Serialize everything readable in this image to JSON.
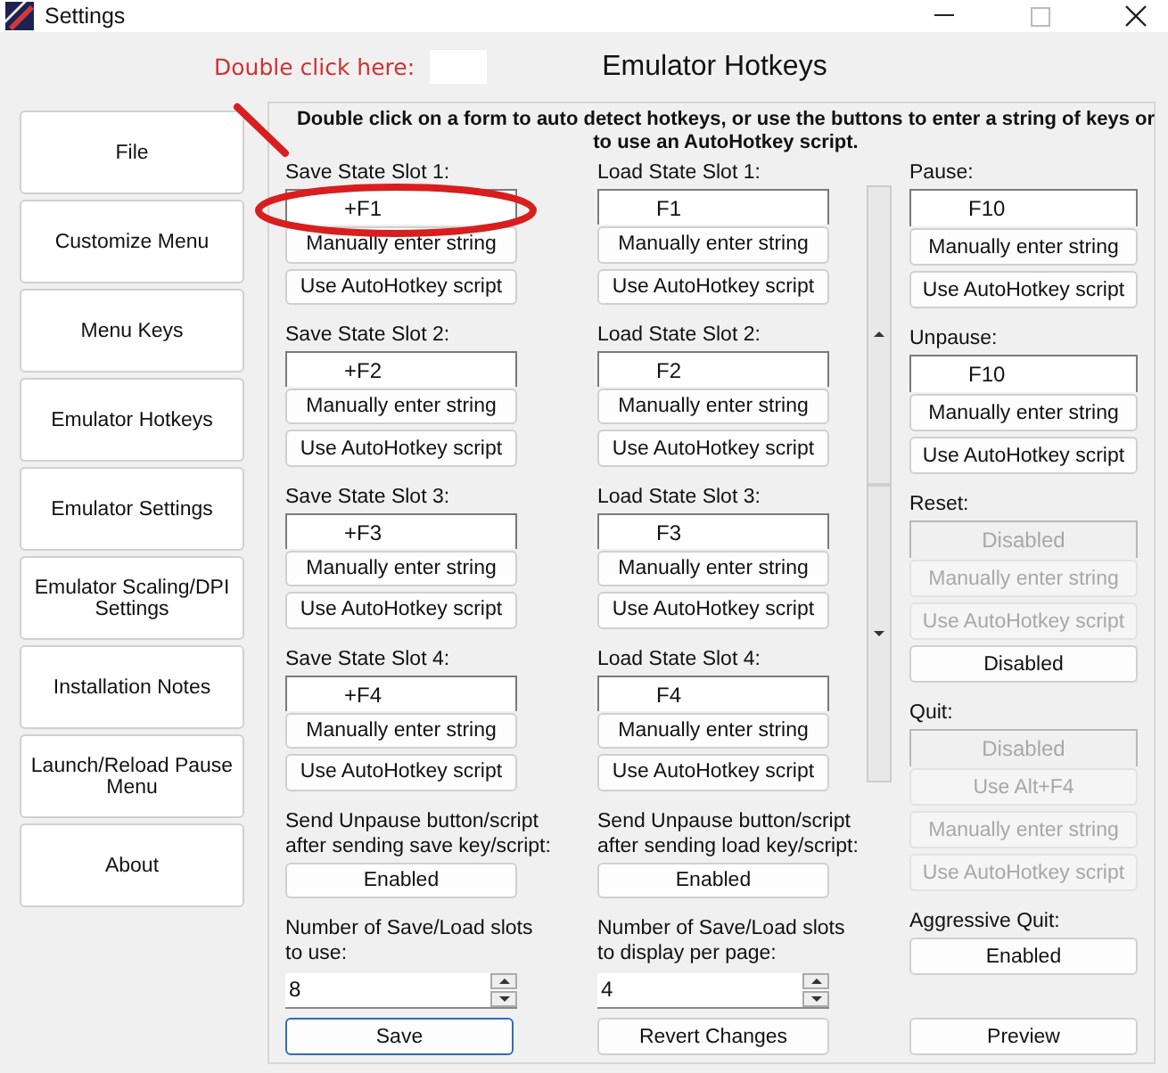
{
  "window": {
    "title": "Settings"
  },
  "annotation": {
    "text": "Double click here:"
  },
  "header": "Emulator Hotkeys",
  "sidebar": {
    "items": [
      {
        "label": "File"
      },
      {
        "label": "Customize Menu"
      },
      {
        "label": "Menu Keys"
      },
      {
        "label": "Emulator Hotkeys"
      },
      {
        "label": "Emulator Settings"
      },
      {
        "label": "Emulator Scaling/DPI Settings"
      },
      {
        "label": "Installation Notes"
      },
      {
        "label": "Launch/Reload Pause Menu"
      },
      {
        "label": "About"
      }
    ]
  },
  "panel": {
    "instructions": "Double click on a form to auto detect hotkeys, or use the buttons to enter a string of keys or to use an AutoHotkey script.",
    "columns": [
      {
        "items": [
          {
            "kind": "label",
            "text": "Save State Slot 1:"
          },
          {
            "kind": "field",
            "value": "+F1",
            "disabled": false
          },
          {
            "kind": "button",
            "label": "Manually enter string",
            "disabled": false
          },
          {
            "kind": "button",
            "label": "Use AutoHotkey script",
            "disabled": false
          },
          {
            "kind": "label",
            "text": "Save State Slot 2:"
          },
          {
            "kind": "field",
            "value": "+F2",
            "disabled": false
          },
          {
            "kind": "button",
            "label": "Manually enter string",
            "disabled": false
          },
          {
            "kind": "button",
            "label": "Use AutoHotkey script",
            "disabled": false
          },
          {
            "kind": "label",
            "text": "Save State Slot 3:"
          },
          {
            "kind": "field",
            "value": "+F3",
            "disabled": false
          },
          {
            "kind": "button",
            "label": "Manually enter string",
            "disabled": false
          },
          {
            "kind": "button",
            "label": "Use AutoHotkey script",
            "disabled": false
          },
          {
            "kind": "label",
            "text": "Save State Slot 4:"
          },
          {
            "kind": "field",
            "value": "+F4",
            "disabled": false
          },
          {
            "kind": "button",
            "label": "Manually enter string",
            "disabled": false
          },
          {
            "kind": "button",
            "label": "Use AutoHotkey script",
            "disabled": false
          },
          {
            "kind": "label",
            "text": "Send Unpause button/script\nafter sending save key/script:"
          },
          {
            "kind": "button",
            "label": "Enabled",
            "disabled": false
          },
          {
            "kind": "label",
            "text": "Number of Save/Load slots\nto use:"
          },
          {
            "kind": "spin",
            "value": "8"
          }
        ]
      },
      {
        "items": [
          {
            "kind": "label",
            "text": "Load State Slot 1:"
          },
          {
            "kind": "field",
            "value": "F1",
            "disabled": false
          },
          {
            "kind": "button",
            "label": "Manually enter string",
            "disabled": false
          },
          {
            "kind": "button",
            "label": "Use AutoHotkey script",
            "disabled": false
          },
          {
            "kind": "label",
            "text": "Load State Slot 2:"
          },
          {
            "kind": "field",
            "value": "F2",
            "disabled": false
          },
          {
            "kind": "button",
            "label": "Manually enter string",
            "disabled": false
          },
          {
            "kind": "button",
            "label": "Use AutoHotkey script",
            "disabled": false
          },
          {
            "kind": "label",
            "text": "Load State Slot 3:"
          },
          {
            "kind": "field",
            "value": "F3",
            "disabled": false
          },
          {
            "kind": "button",
            "label": "Manually enter string",
            "disabled": false
          },
          {
            "kind": "button",
            "label": "Use AutoHotkey script",
            "disabled": false
          },
          {
            "kind": "label",
            "text": "Load State Slot 4:"
          },
          {
            "kind": "field",
            "value": "F4",
            "disabled": false
          },
          {
            "kind": "button",
            "label": "Manually enter string",
            "disabled": false
          },
          {
            "kind": "button",
            "label": "Use AutoHotkey script",
            "disabled": false
          },
          {
            "kind": "label",
            "text": "Send Unpause button/script\nafter sending load key/script:"
          },
          {
            "kind": "button",
            "label": "Enabled",
            "disabled": false
          },
          {
            "kind": "label",
            "text": "Number of Save/Load slots\nto display per page:"
          },
          {
            "kind": "spin",
            "value": "4"
          }
        ]
      },
      {
        "items": [
          {
            "kind": "label",
            "text": "Pause:"
          },
          {
            "kind": "field",
            "value": "F10",
            "disabled": false
          },
          {
            "kind": "button",
            "label": "Manually enter string",
            "disabled": false
          },
          {
            "kind": "button",
            "label": "Use AutoHotkey script",
            "disabled": false
          },
          {
            "kind": "label",
            "text": "Unpause:"
          },
          {
            "kind": "field",
            "value": "F10",
            "disabled": false
          },
          {
            "kind": "button",
            "label": "Manually enter string",
            "disabled": false
          },
          {
            "kind": "button",
            "label": "Use AutoHotkey script",
            "disabled": false
          },
          {
            "kind": "label",
            "text": "Reset:"
          },
          {
            "kind": "field",
            "value": "Disabled",
            "disabled": true
          },
          {
            "kind": "button",
            "label": "Manually enter string",
            "disabled": true
          },
          {
            "kind": "button",
            "label": "Use AutoHotkey script",
            "disabled": true
          },
          {
            "kind": "button",
            "label": "Disabled",
            "disabled": false
          },
          {
            "kind": "label",
            "text": "Quit:"
          },
          {
            "kind": "field",
            "value": "Disabled",
            "disabled": true
          },
          {
            "kind": "button",
            "label": "Use Alt+F4",
            "disabled": true
          },
          {
            "kind": "button",
            "label": "Manually enter string",
            "disabled": true
          },
          {
            "kind": "button",
            "label": "Use AutoHotkey script",
            "disabled": true
          },
          {
            "kind": "label",
            "text": "Aggressive Quit:"
          },
          {
            "kind": "button",
            "label": "Enabled",
            "disabled": false
          }
        ]
      }
    ],
    "footer_buttons": [
      {
        "label": "Save",
        "focused": true
      },
      {
        "label": "Revert Changes",
        "focused": false
      },
      {
        "label": "Preview",
        "focused": false
      }
    ]
  }
}
